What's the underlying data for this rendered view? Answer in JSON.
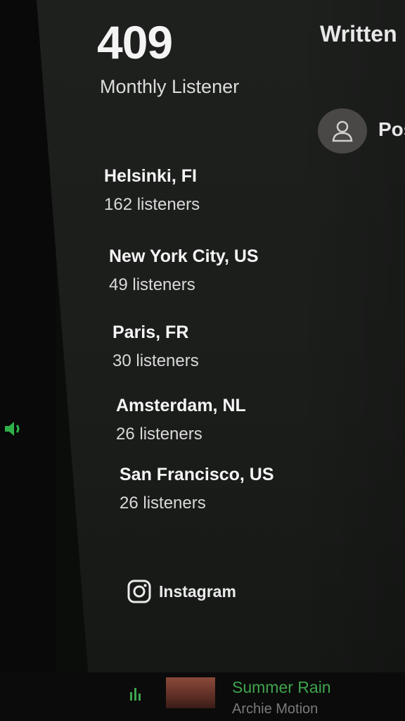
{
  "about": {
    "monthly_listeners": "409",
    "monthly_listeners_label": "Monthly Listener"
  },
  "credits": {
    "header": "Written",
    "person_name": "Pos"
  },
  "top_cities": [
    {
      "name": "Helsinki, FI",
      "listeners": "162 listeners"
    },
    {
      "name": "New York City, US",
      "listeners": "49 listeners"
    },
    {
      "name": "Paris, FR",
      "listeners": "30 listeners"
    },
    {
      "name": "Amsterdam, NL",
      "listeners": "26 listeners"
    },
    {
      "name": "San Francisco, US",
      "listeners": "26 listeners"
    }
  ],
  "social": {
    "instagram_label": "Instagram"
  },
  "now_playing": {
    "title": "Summer Rain",
    "artist": "Archie Motion"
  },
  "colors": {
    "accent_green": "#3fa34d",
    "background": "#1e201e"
  }
}
